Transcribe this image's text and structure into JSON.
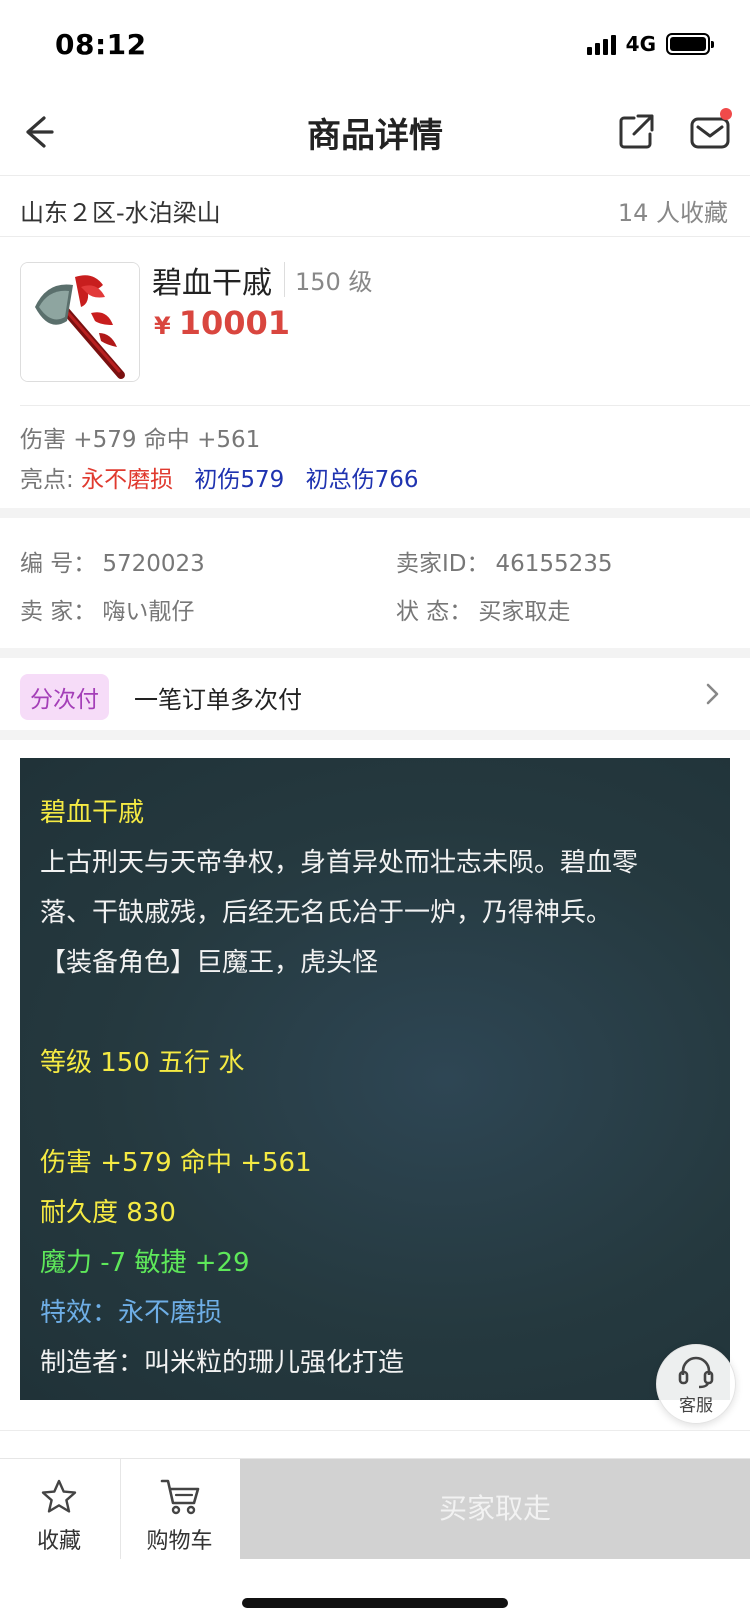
{
  "status_bar": {
    "time": "08:12",
    "network": "4G"
  },
  "nav": {
    "title": "商品详情",
    "icons": [
      "back-arrow-icon",
      "share-icon",
      "mail-icon"
    ]
  },
  "location": {
    "server": "山东２区-水泊梁山",
    "favorites": "14 人收藏"
  },
  "product": {
    "name": "碧血干戚",
    "level": "150 级",
    "currency": "¥",
    "price": "10001"
  },
  "stats": {
    "attributes": "伤害 +579 命中 +561",
    "highlight_label": "亮点:",
    "highlights": [
      "永不磨损",
      "初伤579",
      "初总伤766"
    ]
  },
  "info": {
    "id_label": "编 号：",
    "id_value": "5720023",
    "seller_id_label": "卖家ID：",
    "seller_id_value": "46155235",
    "seller_label": "卖 家：",
    "seller_value": "嗨い靓仔",
    "state_label": "状 态：",
    "state_value": "买家取走"
  },
  "installment": {
    "tag": "分次付",
    "text": "一笔订单多次付"
  },
  "description": {
    "title": "碧血干戚",
    "lore_1": "上古刑天与天帝争权，身首异处而壮志未陨。碧血零",
    "lore_2": "落、干缺戚残，后经无名氏冶于一炉，乃得神兵。",
    "roles": "【装备角色】巨魔王，虎头怪",
    "level_element": "等级 150 五行 水",
    "damage_hit": "伤害 +579 命中 +561",
    "durability": "耐久度 830",
    "magic_agility": "魔力 -7 敏捷 +29",
    "effect": "特效：永不磨损",
    "maker": "制造者：叫米粒的珊儿强化打造"
  },
  "service": {
    "label": "客服"
  },
  "bottom": {
    "favorite": "收藏",
    "cart": "购物车",
    "action": "买家取走"
  },
  "colors": {
    "price": "#d9463f",
    "highlight_red": "#e03a2f",
    "highlight_blue": "#1f33b0",
    "panel_bg": "#25393f",
    "text_yellow": "#f5ea43",
    "text_green": "#5ee85a",
    "text_blue": "#6eaee6",
    "tag_bg": "#f6dcf8",
    "tag_text": "#a43fb8"
  }
}
